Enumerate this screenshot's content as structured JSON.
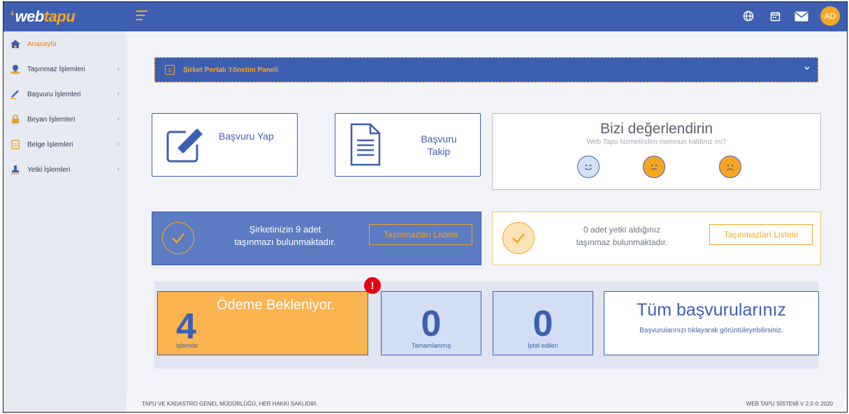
{
  "app": {
    "logo_web": "web",
    "logo_tapu": "tapu"
  },
  "header": {
    "avatar_initials": "AD"
  },
  "sidebar": {
    "items": [
      {
        "label": "Anasayfa"
      },
      {
        "label": "Taşınmaz İşlemleri"
      },
      {
        "label": "Başvuru İşlemleri"
      },
      {
        "label": "Beyan İşlemleri"
      },
      {
        "label": "Belge İşlemleri"
      },
      {
        "label": "Yetki İşlemleri"
      }
    ]
  },
  "panel": {
    "title": "Şirket Portalı Yönetim Paneli"
  },
  "cards": {
    "apply": "Başvuru Yap",
    "track_line1": "Başvuru",
    "track_line2": "Takip"
  },
  "rating": {
    "title": "Bizi değerlendirin",
    "subtitle": "Web Tapu hizmetinden memnun kaldınız mı?"
  },
  "info_company": {
    "line1": "Şirketinizin 9 adet",
    "line2": "taşınmazı bulunmaktadır.",
    "button": "Taşınmazları Listele"
  },
  "info_authority": {
    "line1": "0 adet yetki aldığınız",
    "line2": "taşınmaz bulunmaktadır.",
    "button": "Taşınmazları Listele"
  },
  "stats": {
    "pending": {
      "count": "4",
      "label": "işlemde",
      "title": "Ödeme Bekleniyor."
    },
    "completed": {
      "count": "0",
      "label": "Tamamlanmış"
    },
    "cancelled": {
      "count": "0",
      "label": "İptal edilen"
    },
    "all": {
      "title": "Tüm başvurularınız",
      "subtitle": "Başvurularınızı tıklayarak görüntüleyebilirsiniz."
    },
    "alert_mark": "!"
  },
  "footer": {
    "left": "TAPU VE KADASTRO GENEL MÜDÜRLÜĞÜ, HER HAKKI SAKLIDIR.",
    "right": "WEB TAPU SİSTEMİ V 2.0 © 2020"
  },
  "colors": {
    "brand_blue": "#3e5fb1",
    "accent_orange": "#f6a623",
    "alert_red": "#e60012"
  },
  "icons": [
    "hamburger-icon",
    "globe-icon",
    "calendar-icon",
    "mail-icon",
    "home-icon",
    "edit-icon",
    "document-icon",
    "check-icon"
  ]
}
